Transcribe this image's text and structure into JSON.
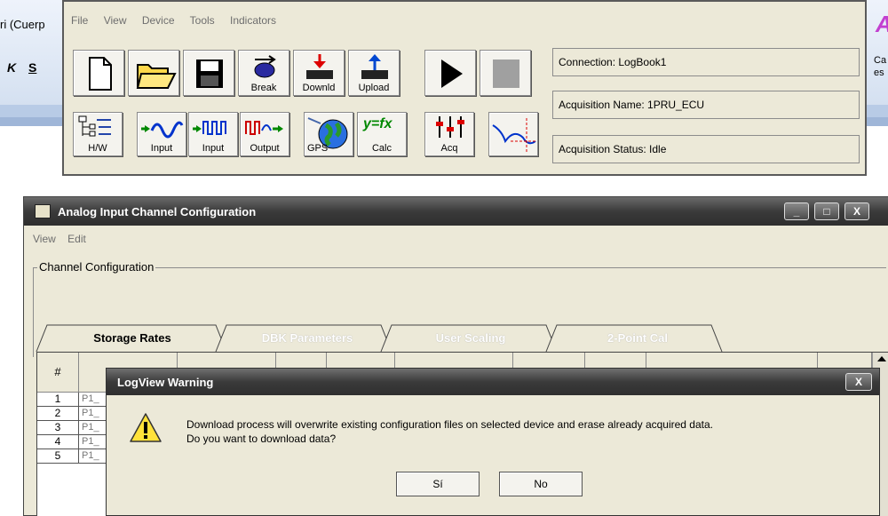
{
  "background_app": {
    "font_box": "ri (Cuerp",
    "bold_btn": "K",
    "underline_btn": "S",
    "right_text_1": "Ca",
    "right_text_2": "es",
    "right_letter": "A"
  },
  "main_window": {
    "menu": [
      "File",
      "View",
      "Device",
      "Tools",
      "Indicators"
    ],
    "toolbar_row1": {
      "break_label": "Break",
      "download_label": "Downld",
      "upload_label": "Upload"
    },
    "toolbar_row2": {
      "hw_label": "H/W",
      "input1_label": "Input",
      "input2_label": "Input",
      "output_label": "Output",
      "gps_label": "GPS",
      "calc_label": "Calc",
      "acq_label": "Acq",
      "formula": "y=fx"
    },
    "connection": "Connection:    LogBook1",
    "acquisition_name": "Acquisition Name:   1PRU_ECU",
    "acquisition_status": "Acquisition Status:  Idle"
  },
  "aic_window": {
    "title": "Analog Input Channel Configuration",
    "menu": [
      "View",
      "Edit"
    ],
    "group_label": "Channel Configuration",
    "tabs": [
      "Storage Rates",
      "DBK Parameters",
      "User Scaling",
      "2-Point Cal"
    ],
    "header_hash": "#",
    "rows": [
      {
        "num": "1",
        "name": "P1_"
      },
      {
        "num": "2",
        "name": "P1_"
      },
      {
        "num": "3",
        "name": "P1_"
      },
      {
        "num": "4",
        "name": "P1_"
      },
      {
        "num": "5",
        "name": "P1_"
      }
    ]
  },
  "warning_dialog": {
    "title": "LogView Warning",
    "message_line1": "Download process will overwrite existing configuration files on selected device and erase already acquired data.",
    "message_line2": "Do you want to download data?",
    "yes_label": "Sí",
    "no_label": "No",
    "close_label": "X"
  }
}
